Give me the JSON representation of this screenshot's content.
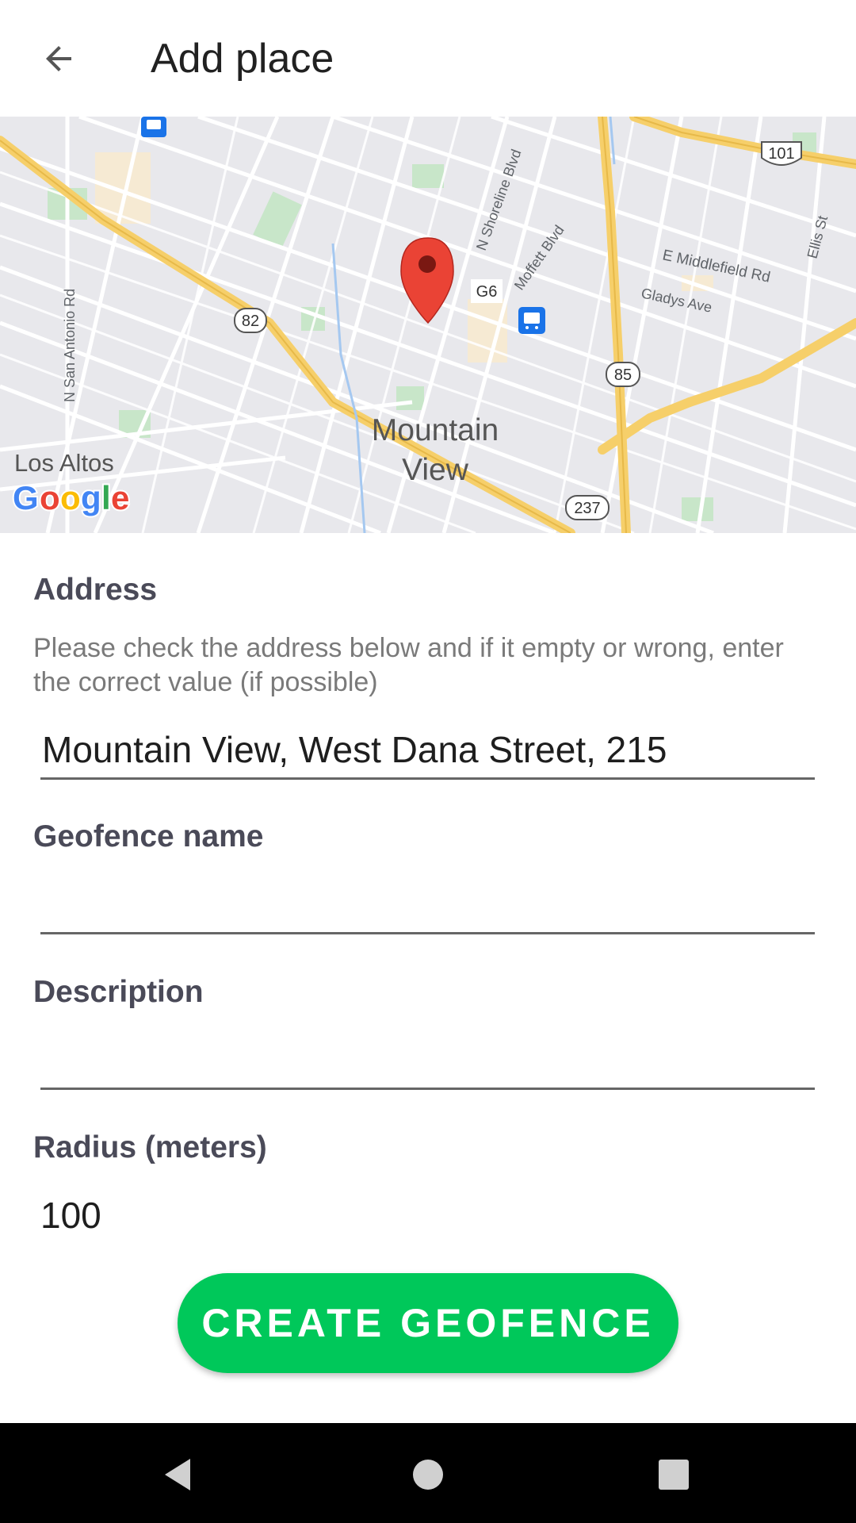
{
  "appbar": {
    "title": "Add place",
    "back_icon": "arrow-back-icon"
  },
  "map": {
    "labels": {
      "city": "Mountain",
      "city2": "View",
      "los_altos": "Los Altos",
      "shoreline": "N Shoreline Blvd",
      "moffett": "Moffett Blvd",
      "middlefield": "E Middlefield Rd",
      "gladys": "Gladys Ave",
      "ellis": "Ellis St",
      "san_antonio": "N San Antonio Rd",
      "g6": "G6",
      "hwy82": "82",
      "hwy85": "85",
      "hwy101": "101",
      "hwy237": "237"
    },
    "google_logo": {
      "G": "G",
      "o1": "o",
      "o2": "o",
      "g": "g",
      "l": "l",
      "e": "e"
    },
    "pin_color": "#ea4335",
    "transit_color": "#1a73e8"
  },
  "form": {
    "address_label": "Address",
    "address_hint": "Please check the address below and if it empty or wrong, enter the correct value (if possible)",
    "address_value": "Mountain View, West Dana Street, 215",
    "geofence_label": "Geofence name",
    "geofence_value": "",
    "description_label": "Description",
    "description_value": "",
    "radius_label": "Radius (meters)",
    "radius_value": "100",
    "create_button": "CREATE GEOFENCE",
    "accent_color": "#00c85a"
  },
  "navbar": {
    "back": "nav-back-icon",
    "home": "nav-home-icon",
    "recents": "nav-recents-icon"
  }
}
